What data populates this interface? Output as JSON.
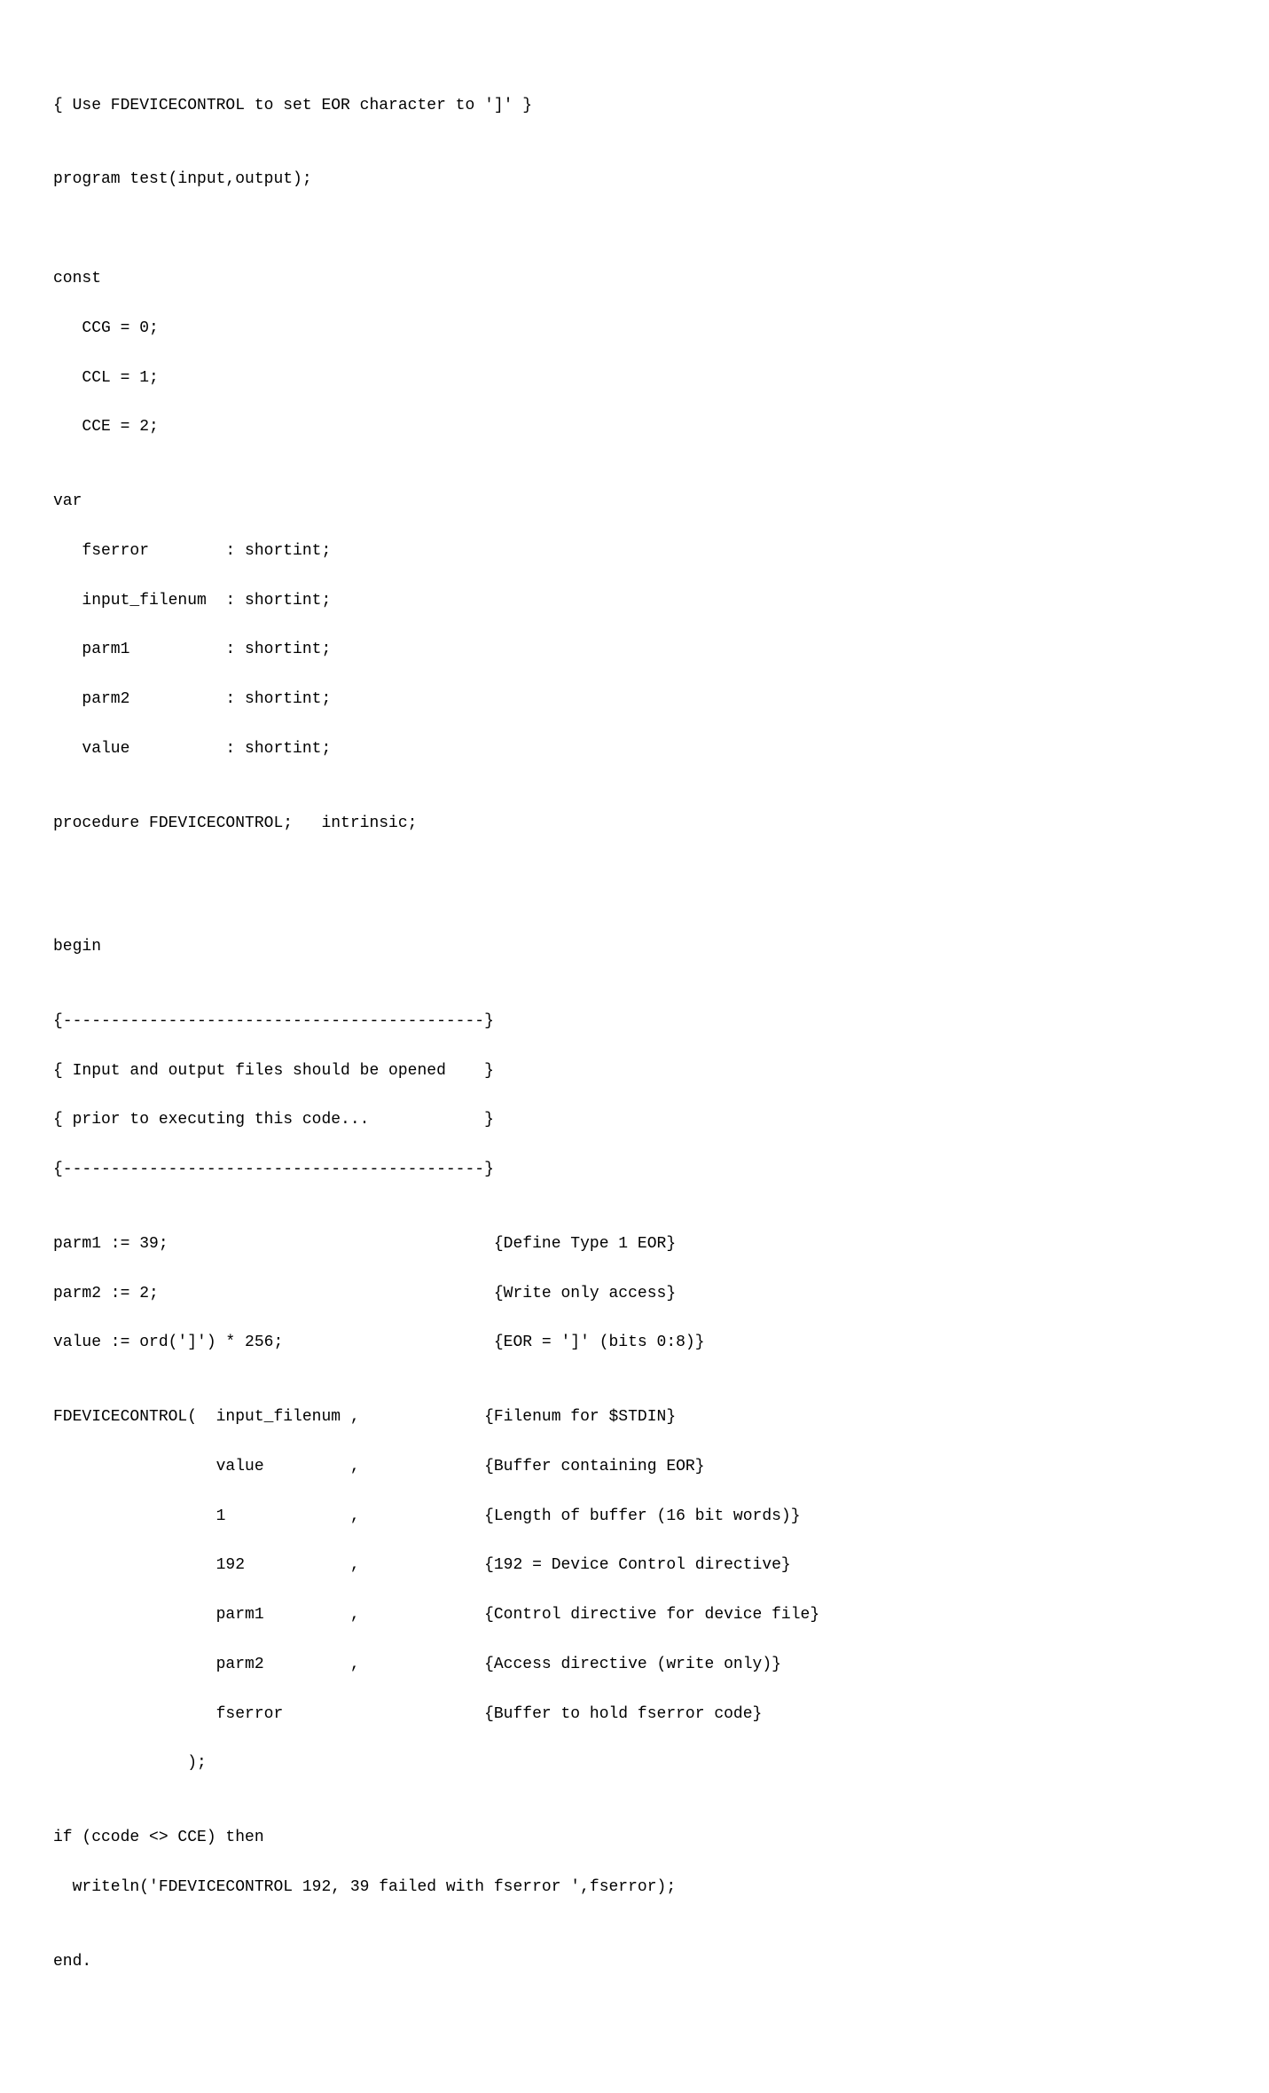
{
  "lines": {
    "l01": "{ Use FDEVICECONTROL to set EOR character to ']' }",
    "l02": "",
    "l03": "program test(input,output);",
    "l04": "",
    "l05": "",
    "l06": "const",
    "l07": "   CCG = 0;",
    "l08": "   CCL = 1;",
    "l09": "   CCE = 2;",
    "l10": "",
    "l11": "var",
    "l12": "   fserror        : shortint;",
    "l13": "   input_filenum  : shortint;",
    "l14": "   parm1          : shortint;",
    "l15": "   parm2          : shortint;",
    "l16": "   value          : shortint;",
    "l17": "",
    "l18": "procedure FDEVICECONTROL;   intrinsic;",
    "l19": "",
    "l20": "",
    "l21": "",
    "l22": "begin",
    "l23": "",
    "l24": "{--------------------------------------------}",
    "l25": "{ Input and output files should be opened    }",
    "l26": "{ prior to executing this code...            }",
    "l27": "{--------------------------------------------}",
    "l28": "",
    "l29": "parm1 := 39;                                  {Define Type 1 EOR}",
    "l30": "parm2 := 2;                                   {Write only access}",
    "l31": "value := ord(']') * 256;                      {EOR = ']' (bits 0:8)}",
    "l32": "",
    "l33": "FDEVICECONTROL(  input_filenum ,             {Filenum for $STDIN}",
    "l34": "                 value         ,             {Buffer containing EOR}",
    "l35": "                 1             ,             {Length of buffer (16 bit words)}",
    "l36": "                 192           ,             {192 = Device Control directive}",
    "l37": "                 parm1         ,             {Control directive for device file}",
    "l38": "                 parm2         ,             {Access directive (write only)}",
    "l39": "                 fserror                     {Buffer to hold fserror code}",
    "l40": "              );",
    "l41": "",
    "l42": "if (ccode <> CCE) then",
    "l43": "  writeln('FDEVICECONTROL 192, 39 failed with fserror ',fserror);",
    "l44": "",
    "l45": "end."
  }
}
